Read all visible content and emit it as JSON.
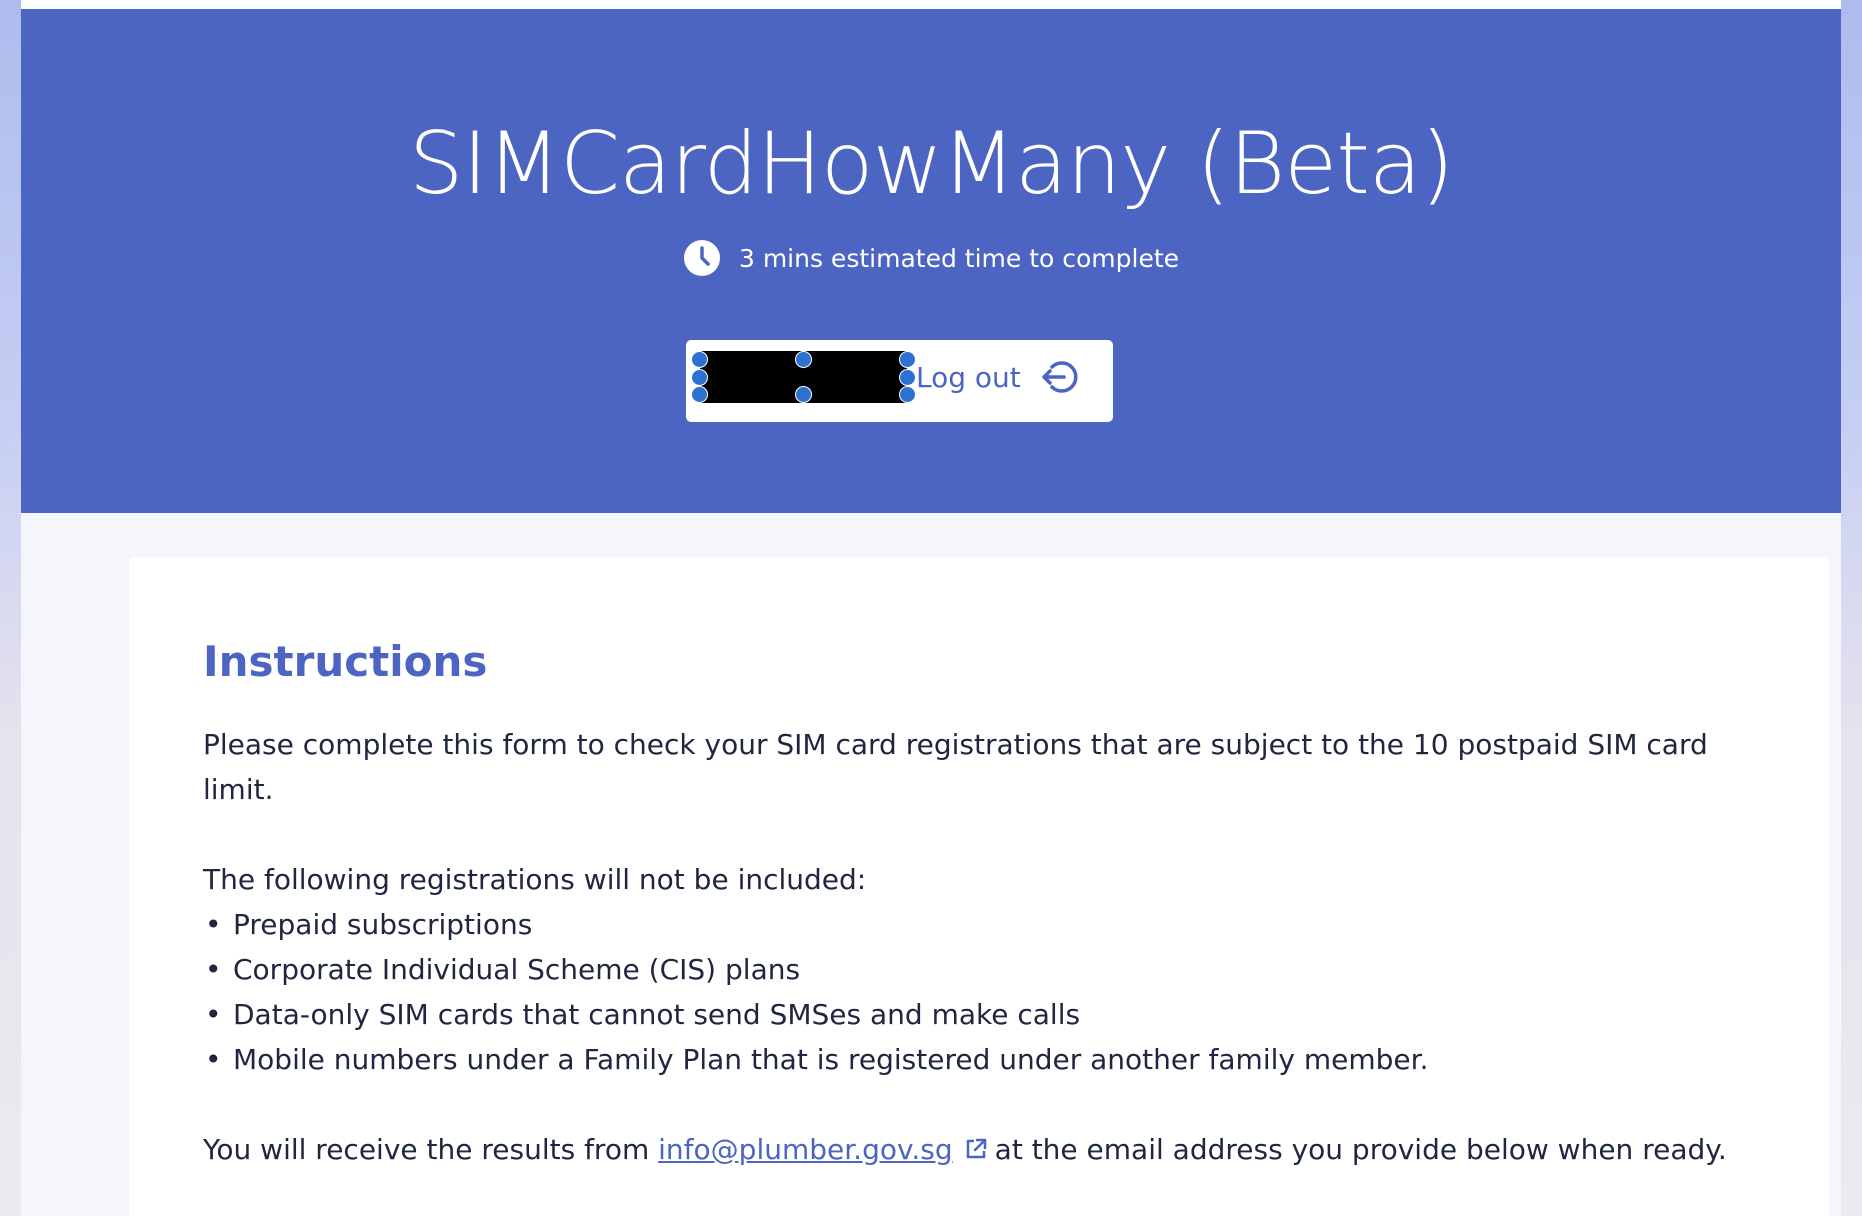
{
  "header": {
    "title": "SIMCardHowMany (Beta)",
    "estimated_time": "3 mins estimated time to complete",
    "logout_label": "Log out"
  },
  "instructions": {
    "title": "Instructions",
    "intro": "Please complete this form to check your SIM card registrations that are subject to the 10 postpaid SIM card limit.",
    "exclusions_heading": "The following registrations will not be included:",
    "exclusions": [
      "Prepaid subscriptions",
      "Corporate Individual Scheme (CIS) plans",
      "Data-only SIM cards that cannot send SMSes and make calls",
      "Mobile numbers under a Family Plan that is registered under another family member."
    ],
    "results_prefix": "You will receive the results from",
    "results_email": "info@plumber.gov.sg",
    "results_suffix": "at the email address you provide below when ready."
  },
  "colors": {
    "brand": "#4d65c2",
    "text": "#1f2640",
    "selection_handle": "#2d72d2"
  },
  "icons": {
    "time": "clock-icon",
    "logout": "logout-icon",
    "external_link": "external-link-icon"
  }
}
